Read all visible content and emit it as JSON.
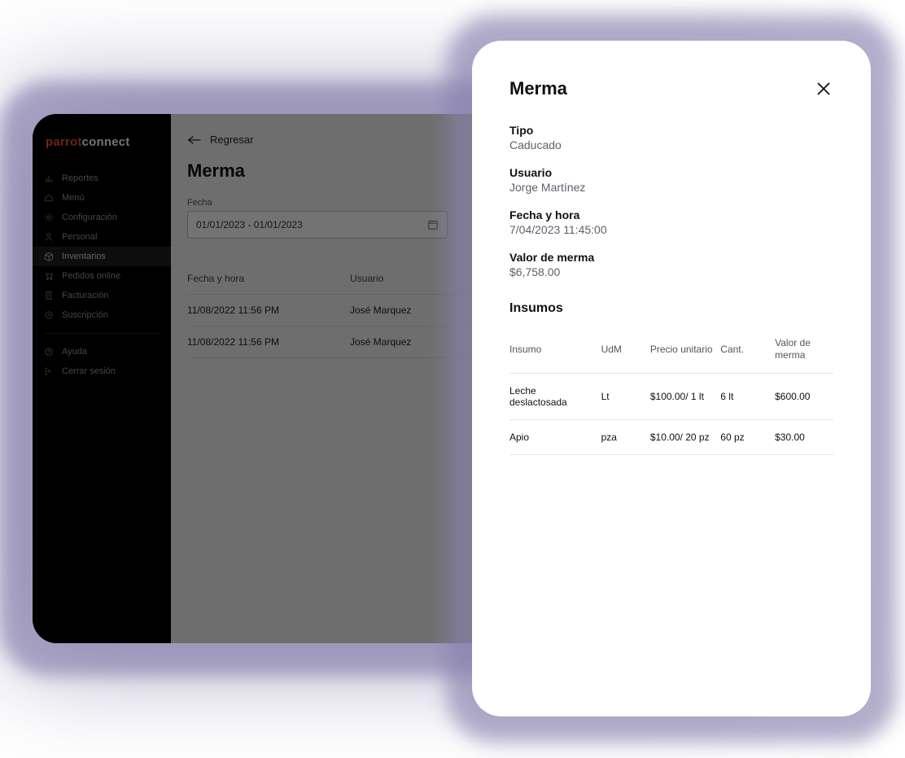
{
  "brand": {
    "part1": "parrot",
    "part2": "connect"
  },
  "sidebar": {
    "items": [
      {
        "label": "Reportes"
      },
      {
        "label": "Menú"
      },
      {
        "label": "Configuración"
      },
      {
        "label": "Personal"
      },
      {
        "label": "Inventarios"
      },
      {
        "label": "Pedidos online"
      },
      {
        "label": "Facturación"
      },
      {
        "label": "Suscripción"
      }
    ],
    "footer": [
      {
        "label": "Ayuda"
      },
      {
        "label": "Cerrar sesión"
      }
    ]
  },
  "main": {
    "back_label": "Regresar",
    "title": "Merma",
    "date_label": "Fecha",
    "date_value": "01/01/2023 - 01/01/2023",
    "columns": {
      "datetime": "Fecha y hora",
      "user": "Usuario"
    },
    "rows": [
      {
        "datetime": "11/08/2022 11:56 PM",
        "user": "José Marquez"
      },
      {
        "datetime": "11/08/2022 11:56 PM",
        "user": "José Marquez"
      }
    ]
  },
  "modal": {
    "title": "Merma",
    "type_label": "Tipo",
    "type_value": "Caducado",
    "user_label": "Usuario",
    "user_value": "Jorge Martínez",
    "datetime_label": "Fecha y hora",
    "datetime_value": "7/04/2023 11:45:00",
    "total_label": "Valor de merma",
    "total_value": "$6,758.00",
    "section_title": "Insumos",
    "columns": {
      "item": "Insumo",
      "uom": "UdM",
      "unit_price": "Precio unitario",
      "qty": "Cant.",
      "value": "Valor de merma"
    },
    "rows": [
      {
        "item": "Leche deslactosada",
        "uom": "Lt",
        "unit_price": "$100.00/ 1 lt",
        "qty": "6 lt",
        "value": "$600.00"
      },
      {
        "item": "Apio",
        "uom": "pza",
        "unit_price": "$10.00/ 20 pz",
        "qty": "60 pz",
        "value": "$30.00"
      }
    ]
  }
}
